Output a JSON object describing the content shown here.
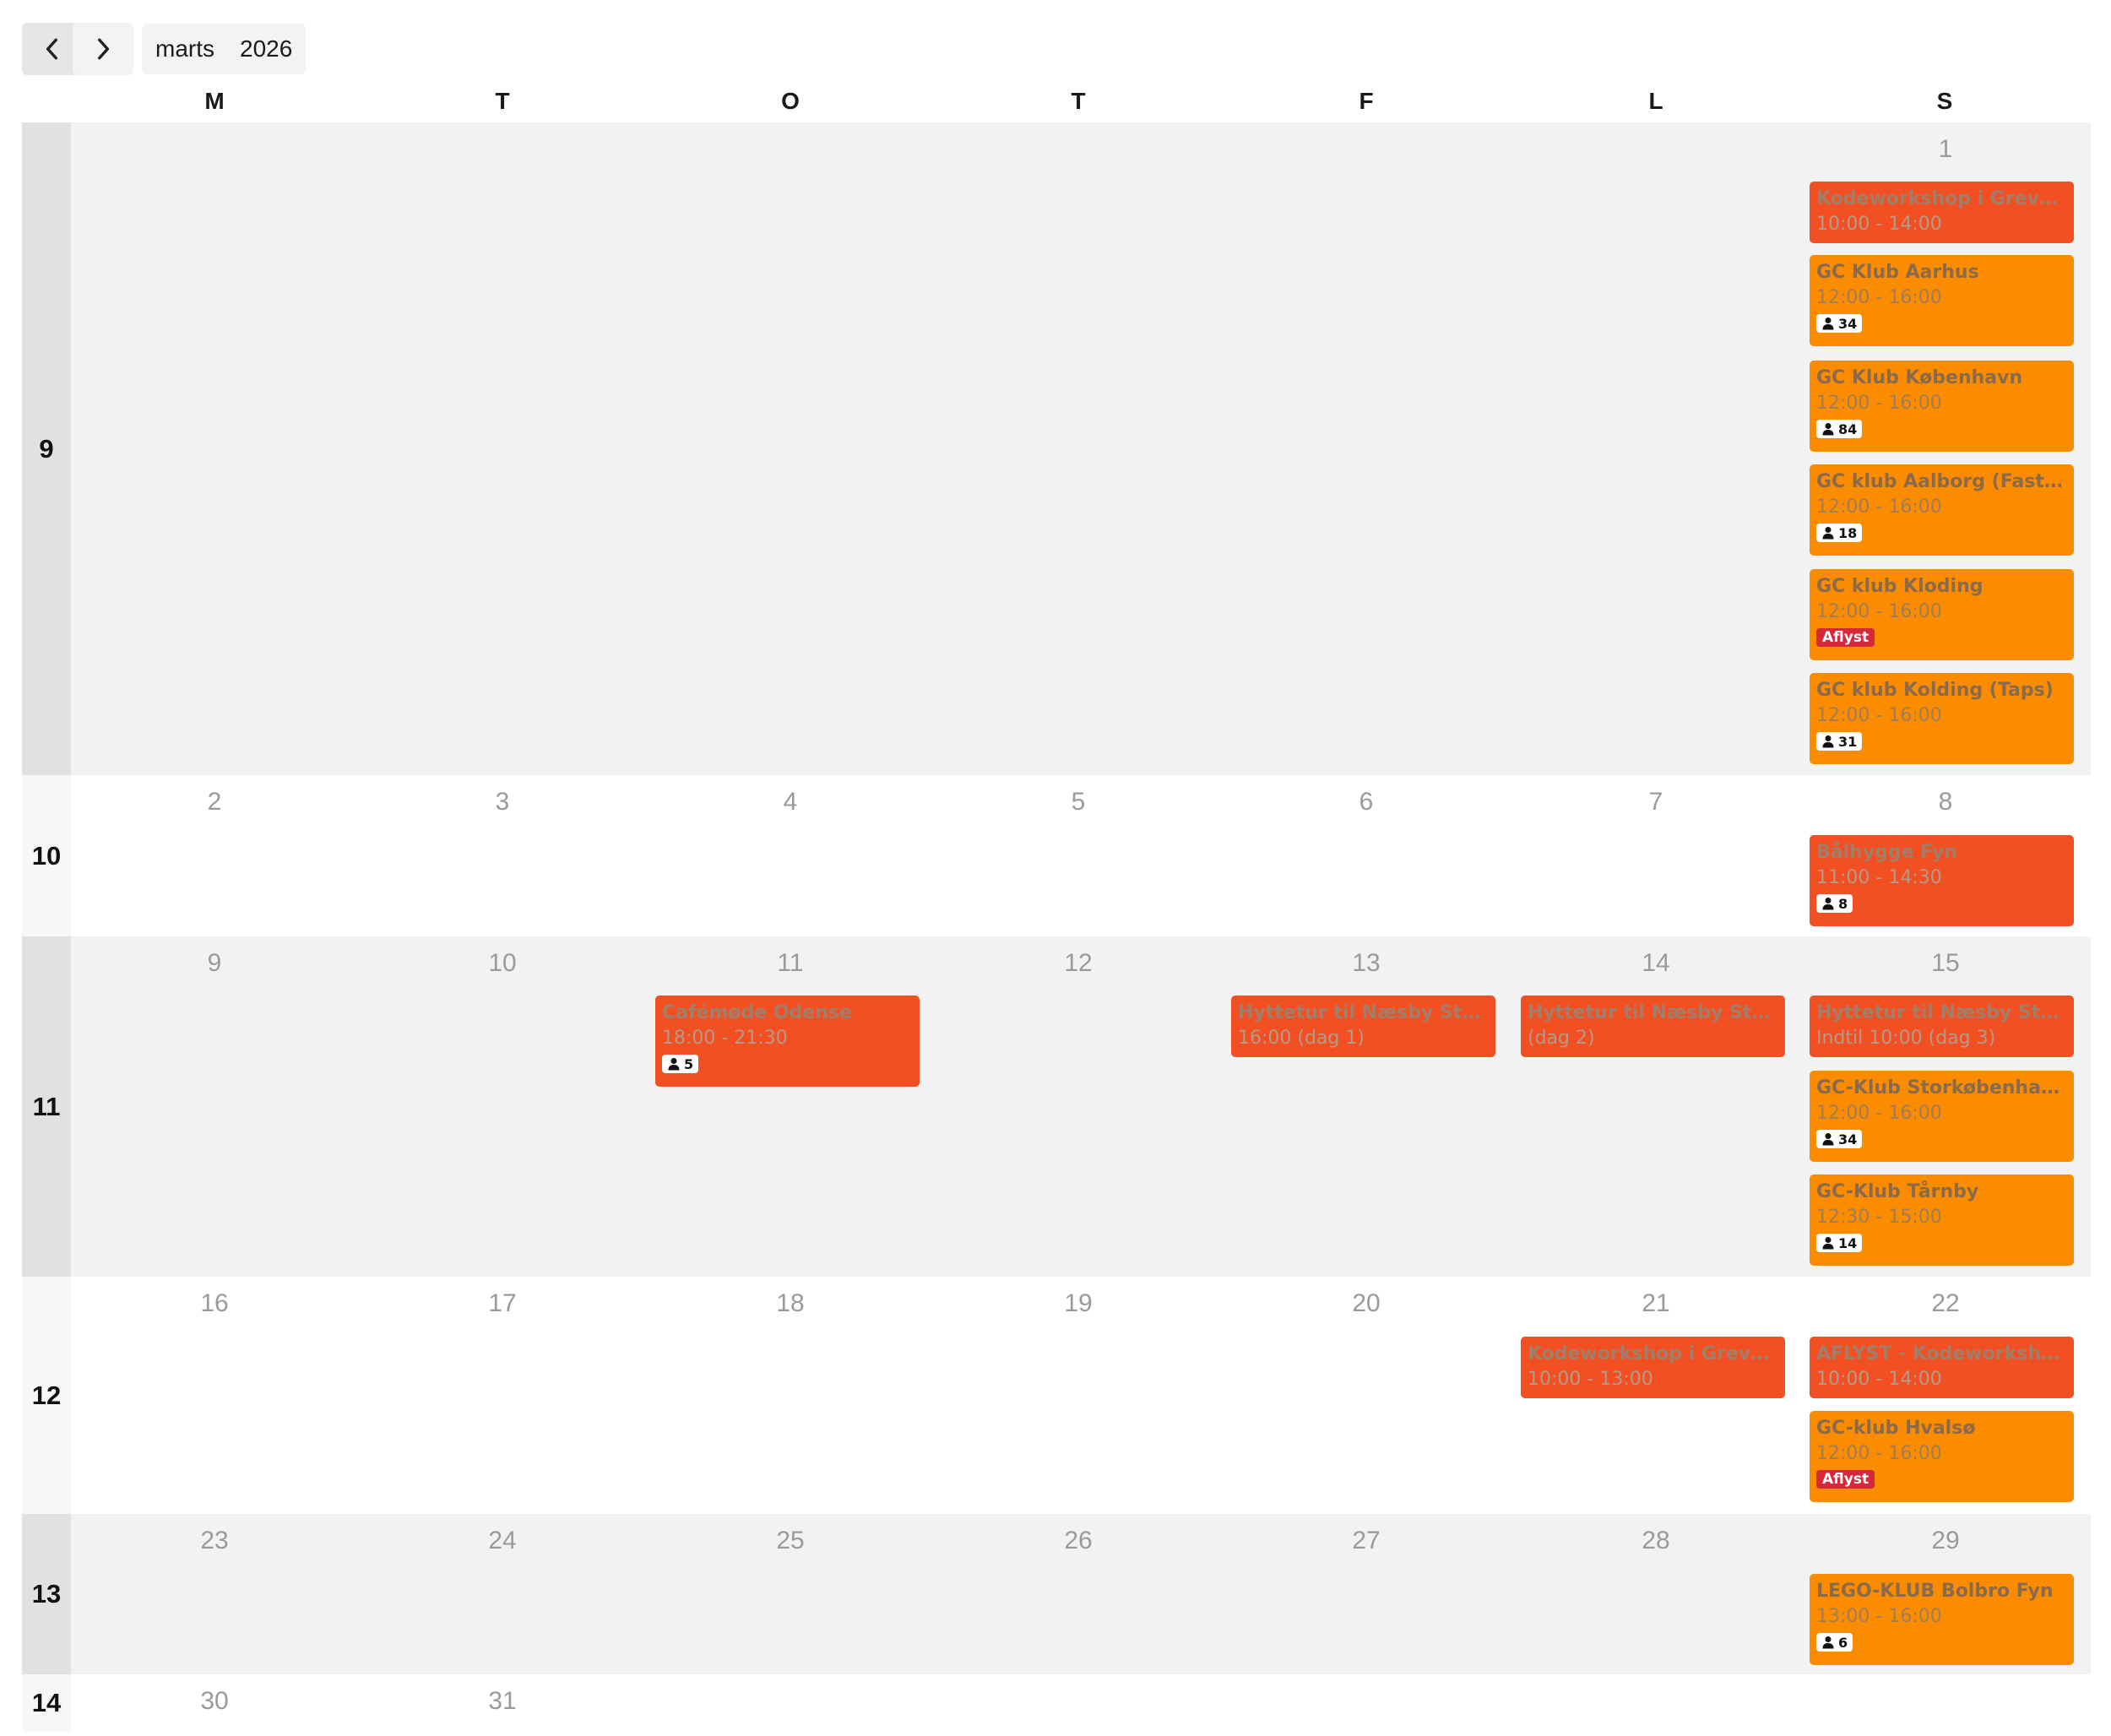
{
  "toolbar": {
    "prev_icon": "chevron-left-icon",
    "next_icon": "chevron-right-icon",
    "month": "marts",
    "year": "2026"
  },
  "weekdays": [
    "M",
    "T",
    "O",
    "T",
    "F",
    "L",
    "S"
  ],
  "weeks": [
    {
      "number": "9",
      "days": [
        "",
        "",
        "",
        "",
        "",
        "",
        "1"
      ]
    },
    {
      "number": "10",
      "days": [
        "2",
        "3",
        "4",
        "5",
        "6",
        "7",
        "8"
      ]
    },
    {
      "number": "11",
      "days": [
        "9",
        "10",
        "11",
        "12",
        "13",
        "14",
        "15"
      ]
    },
    {
      "number": "12",
      "days": [
        "16",
        "17",
        "18",
        "19",
        "20",
        "21",
        "22"
      ]
    },
    {
      "number": "13",
      "days": [
        "23",
        "24",
        "25",
        "26",
        "27",
        "28",
        "29"
      ]
    },
    {
      "number": "14",
      "days": [
        "30",
        "31",
        "",
        "",
        "",
        "",
        ""
      ]
    }
  ],
  "events": [
    {
      "title": "Kodeworkshop i Greve: ...",
      "time": "10:00 - 14:00",
      "color": "#f25022",
      "badge": ""
    },
    {
      "title": "GC Klub Aarhus",
      "time": "12:00 - 16:00",
      "color": "#fb8c00",
      "badge": "34"
    },
    {
      "title": "GC Klub København",
      "time": "12:00 - 16:00",
      "color": "#fb8c00",
      "badge": "84"
    },
    {
      "title": "GC klub Aalborg (Fastel...",
      "time": "12:00 - 16:00",
      "color": "#fb8c00",
      "badge": "18"
    },
    {
      "title": "GC klub Kloding",
      "time": "12:00 - 16:00",
      "color": "#fb8c00",
      "status": "Aflyst"
    },
    {
      "title": "GC klub Kolding (Taps)",
      "time": "12:00 - 16:00",
      "color": "#fb8c00",
      "badge": "31"
    },
    {
      "title": "Bålhygge Fyn",
      "time": "11:00 - 14:30",
      "color": "#f25022",
      "badge": "8"
    },
    {
      "title": "Cafémøde Odense",
      "time": "18:00 - 21:30",
      "color": "#f25022",
      "badge": "5"
    },
    {
      "title": "Hyttetur til Næsby Stra...",
      "time": "16:00 (dag 1)",
      "color": "#f25022",
      "badge": ""
    },
    {
      "title": "Hyttetur til Næsby Stra...",
      "time": "(dag 2)",
      "color": "#f25022",
      "badge": ""
    },
    {
      "title": "Hyttetur til Næsby Stra...",
      "time": "Indtil 10:00 (dag 3)",
      "color": "#f25022",
      "badge": ""
    },
    {
      "title": "GC-Klub Storkøbenhav...",
      "time": "12:00 - 16:00",
      "color": "#fb8c00",
      "badge": "34"
    },
    {
      "title": "GC-Klub Tårnby",
      "time": "12:30 - 15:00",
      "color": "#fb8c00",
      "badge": "14"
    },
    {
      "title": "Kodeworkshop i Greve: ...",
      "time": "10:00 - 13:00",
      "color": "#f25022",
      "badge": ""
    },
    {
      "title": "AFLYST - Kodeworksho...",
      "time": "10:00 - 14:00",
      "color": "#f25022",
      "badge": ""
    },
    {
      "title": "GC-klub Hvalsø",
      "time": "12:00 - 16:00",
      "color": "#fb8c00",
      "status": "Aflyst"
    },
    {
      "title": "LEGO-KLUB Bolbro Fyn",
      "time": "13:00 - 16:00",
      "color": "#fb8c00",
      "badge": "6"
    }
  ]
}
